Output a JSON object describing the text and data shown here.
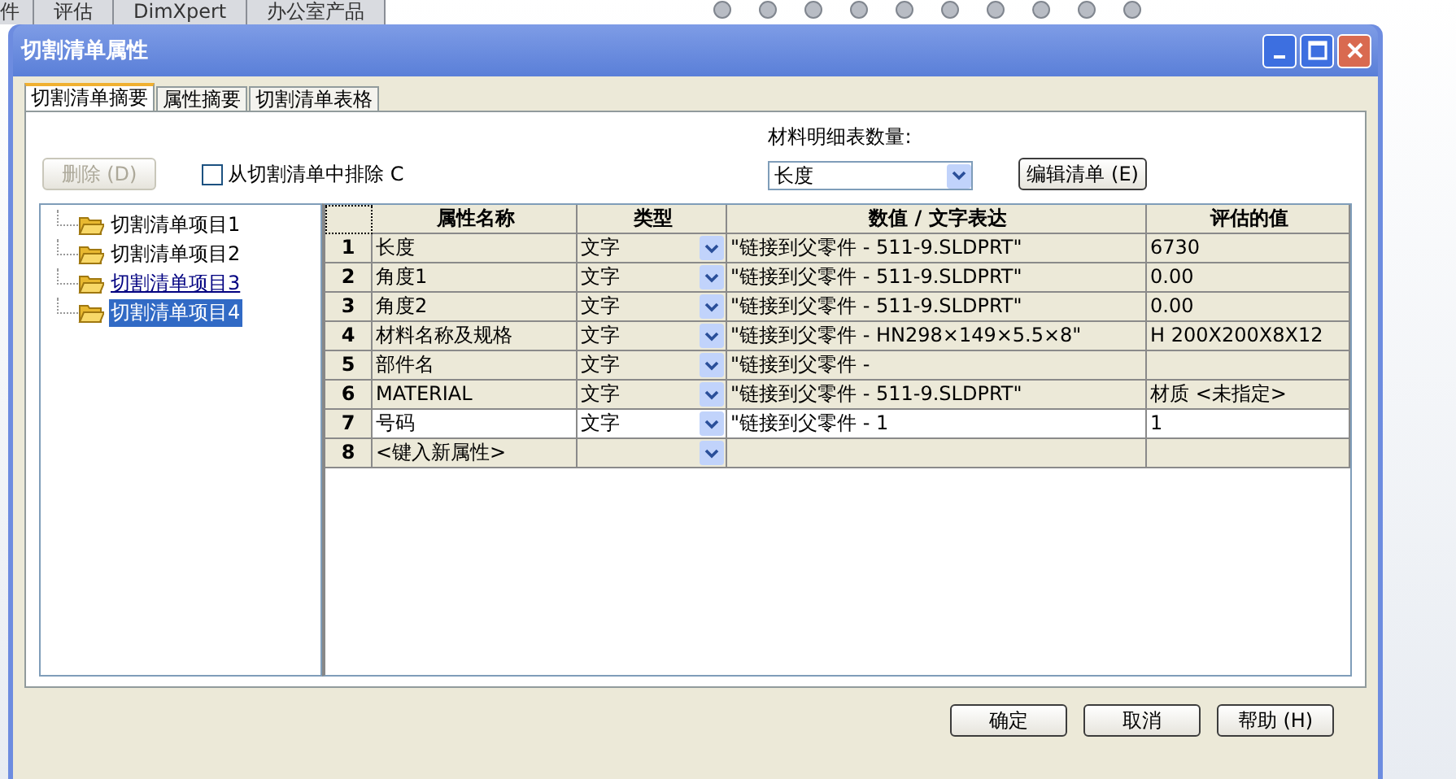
{
  "app_tabs": [
    {
      "label": "件"
    },
    {
      "label": "评估"
    },
    {
      "label": "DimXpert"
    },
    {
      "label": "办公室产品"
    }
  ],
  "window": {
    "title": "切割清单属性"
  },
  "tabs": [
    {
      "label": "切割清单摘要",
      "selected": true
    },
    {
      "label": "属性摘要",
      "selected": false
    },
    {
      "label": "切割清单表格",
      "selected": false
    }
  ],
  "delete_button": {
    "label": "删除 (D)",
    "disabled": true
  },
  "exclude_checkbox": {
    "label": "从切割清单中排除 C",
    "checked": false
  },
  "bom_quantity": {
    "label": "材料明细表数量:",
    "value": "长度"
  },
  "edit_list_button": {
    "label": "编辑清单 (E)"
  },
  "tree": [
    {
      "label": "切割清单项目1",
      "selected": false,
      "hovered": false
    },
    {
      "label": "切割清单项目2",
      "selected": false,
      "hovered": false
    },
    {
      "label": "切割清单项目3",
      "selected": false,
      "hovered": true
    },
    {
      "label": "切割清单项目4",
      "selected": true,
      "hovered": false
    }
  ],
  "table": {
    "columns": [
      "属性名称",
      "类型",
      "数值 / 文字表达",
      "评估的值"
    ],
    "rows": [
      {
        "index": "1",
        "name": "长度",
        "type": "文字",
        "value": "\"链接到父零件 - 511-9.SLDPRT\"",
        "evaluated": "6730",
        "selected": false
      },
      {
        "index": "2",
        "name": "角度1",
        "type": "文字",
        "value": "\"链接到父零件 - 511-9.SLDPRT\"",
        "evaluated": "0.00",
        "selected": false
      },
      {
        "index": "3",
        "name": "角度2",
        "type": "文字",
        "value": "\"链接到父零件 - 511-9.SLDPRT\"",
        "evaluated": "0.00",
        "selected": false
      },
      {
        "index": "4",
        "name": "材料名称及规格",
        "type": "文字",
        "value": "\"链接到父零件 - HN298×149×5.5×8\"",
        "evaluated": "H 200X200X8X12",
        "selected": false
      },
      {
        "index": "5",
        "name": "部件名",
        "type": "文字",
        "value": "\"链接到父零件 -",
        "evaluated": "",
        "selected": false
      },
      {
        "index": "6",
        "name": "MATERIAL",
        "type": "文字",
        "value": "\"链接到父零件 - 511-9.SLDPRT\"",
        "evaluated": "材质 <未指定>",
        "selected": false
      },
      {
        "index": "7",
        "name": "号码",
        "type": "文字",
        "value": "\"链接到父零件 - 1",
        "evaluated": "1",
        "selected": true
      },
      {
        "index": "8",
        "name": "<键入新属性>",
        "type": "",
        "value": "",
        "evaluated": "",
        "selected": false
      }
    ]
  },
  "buttons": [
    "确定",
    "取消",
    "帮助 (H)"
  ]
}
